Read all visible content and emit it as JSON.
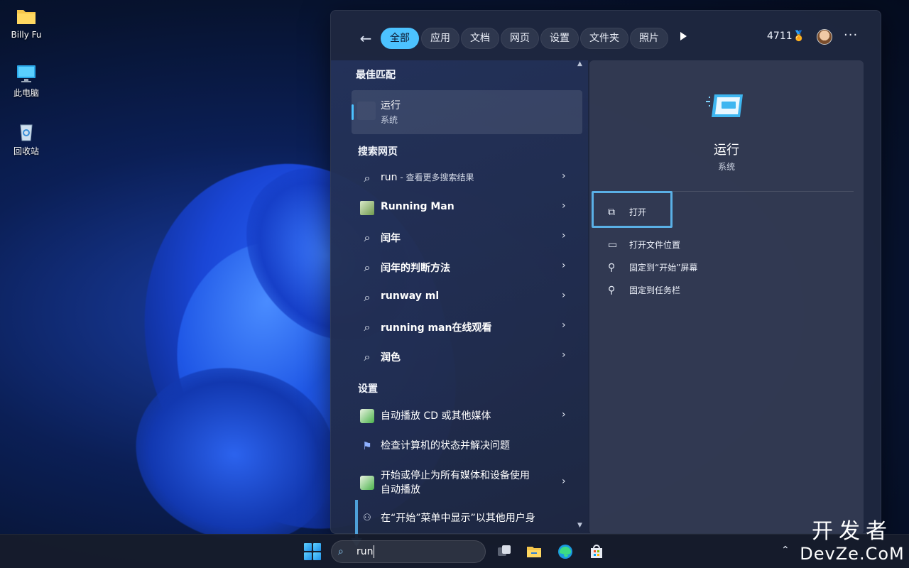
{
  "desktop": {
    "icons": [
      {
        "label": "Billy Fu",
        "icon": "folder-icon"
      },
      {
        "label": "此电脑",
        "icon": "computer-icon"
      },
      {
        "label": "回收站",
        "icon": "recycle-bin-icon"
      }
    ]
  },
  "search_panel": {
    "tabs": [
      "全部",
      "应用",
      "文档",
      "网页",
      "设置",
      "文件夹",
      "照片"
    ],
    "active_tab": "全部",
    "points": "4711",
    "sections": {
      "best_match": "最佳匹配",
      "web": "搜索网页",
      "settings": "设置"
    },
    "best_match": {
      "title": "运行",
      "subtitle": "系统"
    },
    "web_results": [
      {
        "text": "run",
        "suffix": " - 查看更多搜索结果",
        "icon": "search-icon"
      },
      {
        "text": "Running Man",
        "suffix": "",
        "icon": "image-thumbnail-icon"
      },
      {
        "text": "闰年",
        "suffix": "",
        "icon": "search-icon"
      },
      {
        "text": "闰年的判断方法",
        "suffix": "",
        "icon": "search-icon"
      },
      {
        "text": "runway ml",
        "suffix": "",
        "icon": "search-icon"
      },
      {
        "text": "running man在线观看",
        "suffix": "",
        "icon": "search-icon"
      },
      {
        "text": "润色",
        "suffix": "",
        "icon": "search-icon"
      }
    ],
    "settings_results": [
      {
        "text": "自动播放 CD 或其他媒体",
        "icon": "autoplay-icon"
      },
      {
        "text": "检查计算机的状态并解决问题",
        "icon": "flag-icon"
      },
      {
        "text": "开始或停止为所有媒体和设备使用",
        "text2": "自动播放",
        "icon": "autoplay-icon"
      },
      {
        "text": "在“开始”菜单中显示”以其他用户身",
        "icon": "user-icon"
      }
    ],
    "preview": {
      "title": "运行",
      "subtitle": "系统",
      "actions": [
        {
          "label": "打开",
          "icon": "open-external-icon"
        },
        {
          "label": "打开文件位置",
          "icon": "folder-open-icon"
        },
        {
          "label": "固定到“开始”屏幕",
          "icon": "pin-icon"
        },
        {
          "label": "固定到任务栏",
          "icon": "pin-icon"
        }
      ]
    }
  },
  "taskbar": {
    "search_value": "run"
  },
  "watermark": {
    "line1": "开发者",
    "line2": "DevZe.CoM"
  },
  "colors": {
    "accent": "#4cc2ff",
    "highlight": "#5ab0e6"
  }
}
